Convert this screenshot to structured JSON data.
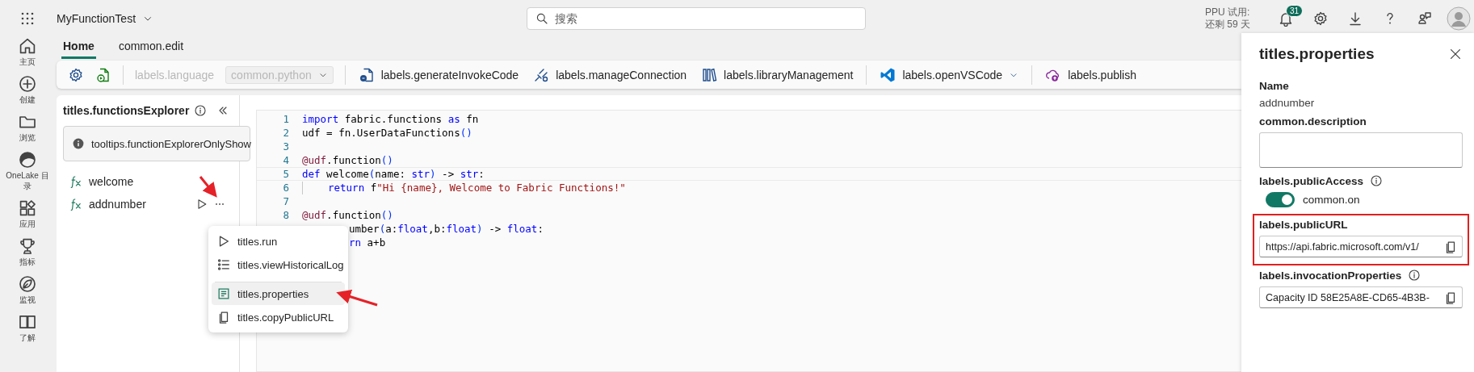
{
  "app_bar": {
    "workspace": "MyFunctionTest",
    "search_placeholder": "搜索",
    "trial": [
      "PPU 试用:",
      "还剩 59 天"
    ],
    "notifications": "31",
    "actions": [
      {
        "kind": "settings"
      },
      {
        "kind": "download"
      },
      {
        "kind": "help"
      },
      {
        "kind": "share"
      }
    ]
  },
  "nav": [
    {
      "label": "主页",
      "kind": "home"
    },
    {
      "label": "创建",
      "kind": "create"
    },
    {
      "label": "浏览",
      "kind": "browse"
    },
    {
      "label": "OneLake 目录",
      "kind": "onelake"
    },
    {
      "label": "应用",
      "kind": "apps"
    },
    {
      "label": "指标",
      "kind": "metrics"
    },
    {
      "label": "监视",
      "kind": "monitor"
    },
    {
      "label": "了解",
      "kind": "learn"
    }
  ],
  "tabs": [
    {
      "label": "Home",
      "selected": true
    },
    {
      "label": "common.edit",
      "selected": false
    }
  ],
  "toolbar": [
    {
      "kind": "settings"
    },
    {
      "kind": "runfile"
    },
    {
      "kind": "separator"
    },
    {
      "kind": "language",
      "label": "labels.language",
      "disabled": true
    },
    {
      "kind": "dropdown",
      "value": "common.python",
      "disabled": true
    },
    {
      "kind": "separator"
    },
    {
      "kind": "invoke",
      "label": "labels.generateInvokeCode",
      "disabled": false
    },
    {
      "kind": "connection",
      "label": "labels.manageConnection",
      "disabled": false
    },
    {
      "kind": "library",
      "label": "labels.libraryManagement",
      "disabled": false
    },
    {
      "kind": "separator"
    },
    {
      "kind": "vscode",
      "label": "labels.openVSCode",
      "disabled": false
    },
    {
      "kind": "separator"
    },
    {
      "kind": "publish",
      "label": "labels.publish",
      "disabled": false
    }
  ],
  "explorer": {
    "title": "titles.functionsExplorer",
    "notice": "tooltips.functionExplorerOnlyShow",
    "functions": [
      {
        "name": "welcome",
        "hovered": false
      },
      {
        "name": "addnumber",
        "hovered": true
      }
    ]
  },
  "context_menu": [
    {
      "label": "titles.run",
      "kind": "run",
      "selected": false,
      "separator_before": false
    },
    {
      "label": "titles.viewHistoricalLog",
      "kind": "log",
      "selected": false,
      "separator_before": false
    },
    {
      "label": "titles.properties",
      "kind": "properties",
      "selected": true,
      "separator_before": true
    },
    {
      "label": "titles.copyPublicURL",
      "kind": "copy",
      "selected": false,
      "separator_before": false
    }
  ],
  "editor": {
    "lines": [
      {
        "n": "1",
        "kind": "full",
        "current": false,
        "tokens": [
          {
            "t": "import",
            "kind": "kw"
          },
          {
            "t": " fabric.functions ",
            "kind": "id"
          },
          {
            "t": "as",
            "kind": "kw"
          },
          {
            "t": " fn",
            "kind": "id"
          }
        ]
      },
      {
        "n": "2",
        "kind": "full",
        "current": false,
        "tokens": [
          {
            "t": "udf = fn.UserDataFunctions",
            "kind": "id"
          },
          {
            "t": "()",
            "kind": "paren"
          }
        ]
      },
      {
        "n": "3",
        "kind": "full",
        "current": false
      },
      {
        "n": "4",
        "kind": "full",
        "current": false,
        "tokens": [
          {
            "t": "@udf",
            "kind": "deco"
          },
          {
            "t": ".function",
            "kind": "id"
          },
          {
            "t": "()",
            "kind": "paren"
          }
        ]
      },
      {
        "n": "5",
        "kind": "full",
        "current": true,
        "tokens": [
          {
            "t": "def",
            "kind": "kw"
          },
          {
            "t": " welcome",
            "kind": "id"
          },
          {
            "t": "(",
            "kind": "paren"
          },
          {
            "t": "name: ",
            "kind": "id"
          },
          {
            "t": "str",
            "kind": "kw"
          },
          {
            "t": ")",
            "kind": "paren"
          },
          {
            "t": " -> ",
            "kind": "id"
          },
          {
            "t": "str",
            "kind": "kw"
          },
          {
            "t": ":",
            "kind": "id"
          }
        ]
      },
      {
        "n": "6",
        "kind": "indented",
        "current": false,
        "tokens": [
          {
            "t": "return",
            "kind": "kw"
          },
          {
            "t": " f",
            "kind": "id"
          },
          {
            "t": "\"Hi {name}, Welcome to Fabric Functions!\"",
            "kind": "str"
          }
        ]
      },
      {
        "n": "7",
        "kind": "full",
        "current": false
      },
      {
        "n": "8",
        "kind": "full",
        "current": false,
        "tokens": [
          {
            "t": "@udf",
            "kind": "deco"
          },
          {
            "t": ".function",
            "kind": "id"
          },
          {
            "t": "()",
            "kind": "paren"
          }
        ]
      },
      {
        "kind": "covered",
        "current": false,
        "tokens": [
          {
            "t": "umber",
            "kind": "id"
          },
          {
            "t": "(",
            "kind": "paren"
          },
          {
            "t": "a:",
            "kind": "id"
          },
          {
            "t": "float",
            "kind": "kw"
          },
          {
            "t": ",b:",
            "kind": "id"
          },
          {
            "t": "float",
            "kind": "kw"
          },
          {
            "t": ")",
            "kind": "paren"
          },
          {
            "t": " -> ",
            "kind": "id"
          },
          {
            "t": "float",
            "kind": "kw"
          },
          {
            "t": ":",
            "kind": "id"
          }
        ]
      },
      {
        "kind": "covered",
        "current": false,
        "tokens": [
          {
            "t": "rn",
            "kind": "kw"
          },
          {
            "t": " a+b",
            "kind": "id"
          }
        ]
      }
    ]
  },
  "properties": {
    "title": "titles.properties",
    "sections": [
      {
        "kind": "text",
        "label": "Name",
        "value": "addnumber",
        "info": false,
        "highlighted": false
      },
      {
        "kind": "textarea",
        "label": "common.description",
        "info": false,
        "highlighted": false
      },
      {
        "kind": "toggle",
        "label": "labels.publicAccess",
        "info": true,
        "on": true,
        "state_label": "common.on",
        "highlighted": false
      },
      {
        "kind": "copy",
        "label": "labels.publicURL",
        "value": "https://api.fabric.microsoft.com/v1/",
        "info": false,
        "highlighted": true
      },
      {
        "kind": "copy",
        "label": "labels.invocationProperties",
        "value": "Capacity ID 58E25A8E-CD65-4B3B-",
        "info": true,
        "highlighted": false
      }
    ]
  }
}
